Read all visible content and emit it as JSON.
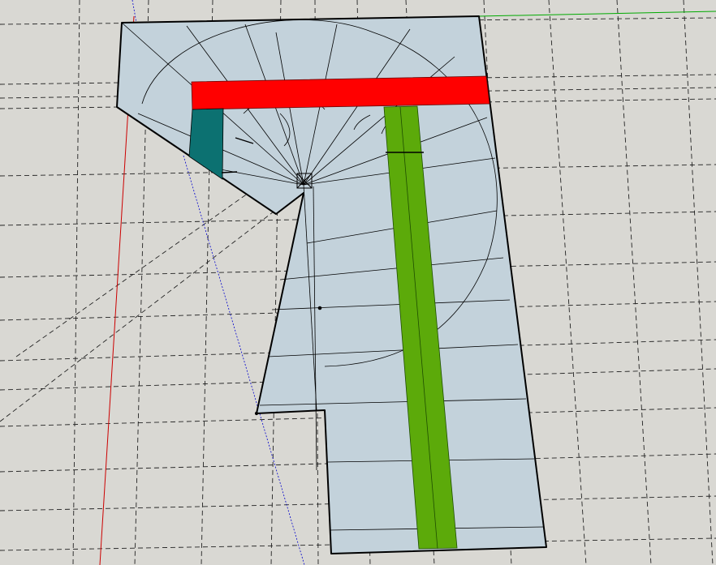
{
  "canvas": {
    "background": "#d9d8d3"
  },
  "colors": {
    "face_fill": "#c3d2db",
    "red_beam": "#ff0000",
    "green_beam": "#5caa0a",
    "teal_block": "#0c7171",
    "edge": "#000000",
    "guide_line": "#222222",
    "axis_red": "#cc0000",
    "axis_green": "#00aa00",
    "axis_blue": "#0000cc"
  },
  "scene": {
    "description_items": [
      "cutting-plate-face",
      "red-horizontal-beam",
      "green-vertical-beam",
      "teal-corner-block",
      "construction-guides",
      "model-axes"
    ]
  }
}
